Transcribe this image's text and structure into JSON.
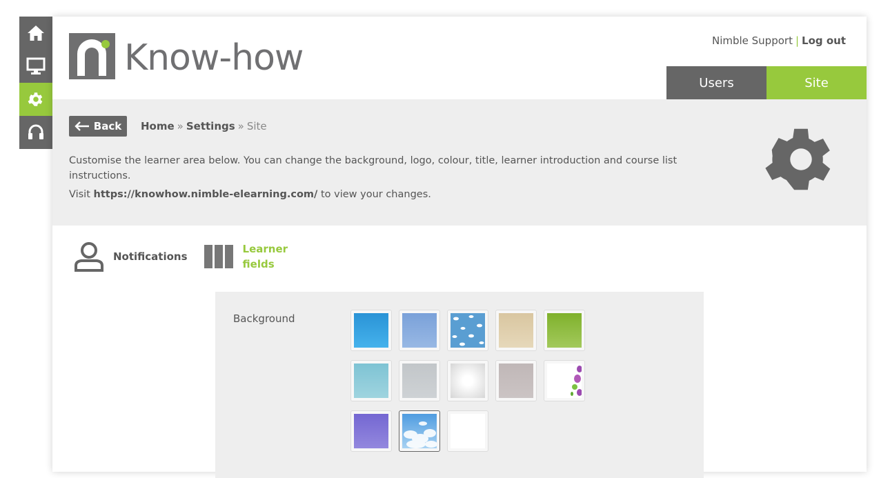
{
  "rail": {
    "items": [
      {
        "name": "home-icon"
      },
      {
        "name": "monitor-icon"
      },
      {
        "name": "gear-icon",
        "active": true
      },
      {
        "name": "headset-icon"
      }
    ]
  },
  "header": {
    "logo_text": "Know-how",
    "user_name": "Nimble Support",
    "separator": "|",
    "logout_label": "Log out",
    "tabs": [
      {
        "label": "Users",
        "active": false
      },
      {
        "label": "Site",
        "active": true
      }
    ]
  },
  "page": {
    "back_label": "Back",
    "breadcrumb": {
      "home": "Home",
      "settings": "Settings",
      "current": "Site",
      "sep": "»"
    },
    "intro": "Customise the learner area below. You can change the background, logo, colour, title, learner introduction and course list instructions.",
    "visit_prefix": "Visit",
    "visit_url": "https://knowhow.nimble-elearning.com/",
    "visit_suffix": "to view your changes."
  },
  "subnav": {
    "notifications_label": "Notifications",
    "learner_fields_line1": "Learner",
    "learner_fields_line2": "fields"
  },
  "settings": {
    "background_label": "Background",
    "swatches": [
      {
        "name": "blue",
        "color": "#2f9fe0"
      },
      {
        "name": "periwinkle",
        "color": "#7fa6dc"
      },
      {
        "name": "clouds-pattern",
        "color": "#5a9ed2"
      },
      {
        "name": "sand",
        "color": "#dccba7"
      },
      {
        "name": "green",
        "color": "#86b83b"
      },
      {
        "name": "aqua",
        "color": "#87c9d8"
      },
      {
        "name": "silver",
        "color": "#c5c9cc"
      },
      {
        "name": "white-radial",
        "color": "#eaeaea"
      },
      {
        "name": "taupe",
        "color": "#c4bcbc"
      },
      {
        "name": "bubbles",
        "color": "#ffffff"
      },
      {
        "name": "violet",
        "color": "#7f73d6"
      },
      {
        "name": "sky",
        "color": "#6cb1e8",
        "selected": true
      },
      {
        "name": "white",
        "color": "#ffffff"
      }
    ]
  },
  "colors": {
    "accent": "#97c93d",
    "dark": "#666666",
    "panel": "#eeeeee"
  }
}
